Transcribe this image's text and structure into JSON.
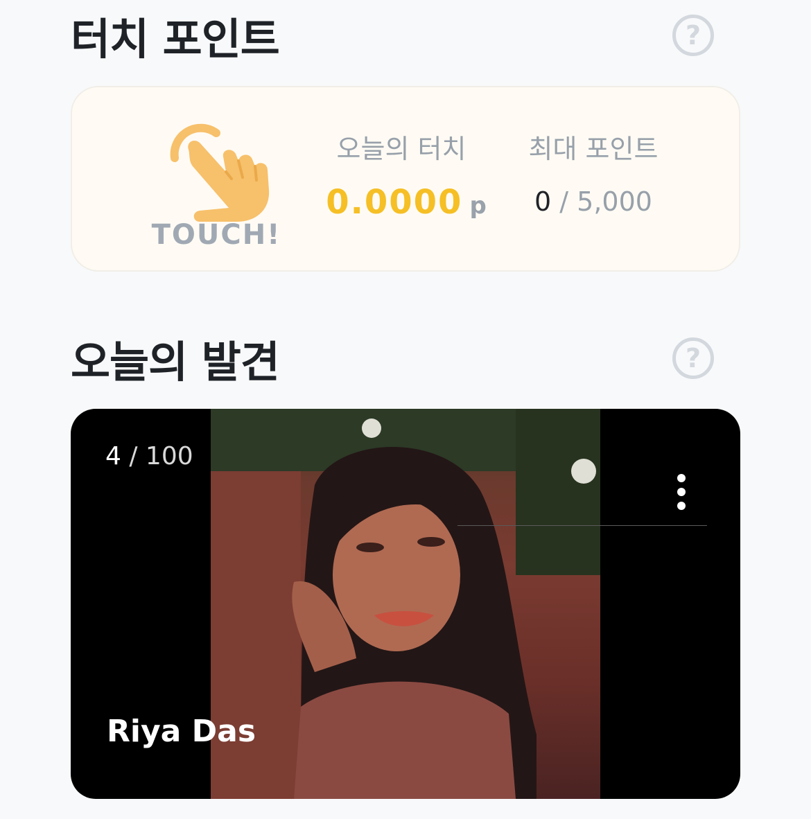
{
  "touch_section": {
    "title": "터치 포인트",
    "help_symbol": "?",
    "touch_button_label": "TOUCH!",
    "today": {
      "label": "오늘의 터치",
      "value": "0.0000",
      "unit": "p"
    },
    "max": {
      "label": "최대 포인트",
      "current": "0",
      "separator": " / ",
      "limit": "5,000"
    }
  },
  "discover_section": {
    "title": "오늘의 발견",
    "help_symbol": "?",
    "card": {
      "counter_current": "4",
      "counter_separator": " / ",
      "counter_total": "100",
      "profile_name": "Riya Das"
    }
  },
  "colors": {
    "accent_yellow": "#f5bf25",
    "hand_icon_orange": "#f7c06b",
    "muted_text": "#97a0aa"
  },
  "icons": [
    "help-icon",
    "touch-hand-icon",
    "more-vertical-icon"
  ]
}
